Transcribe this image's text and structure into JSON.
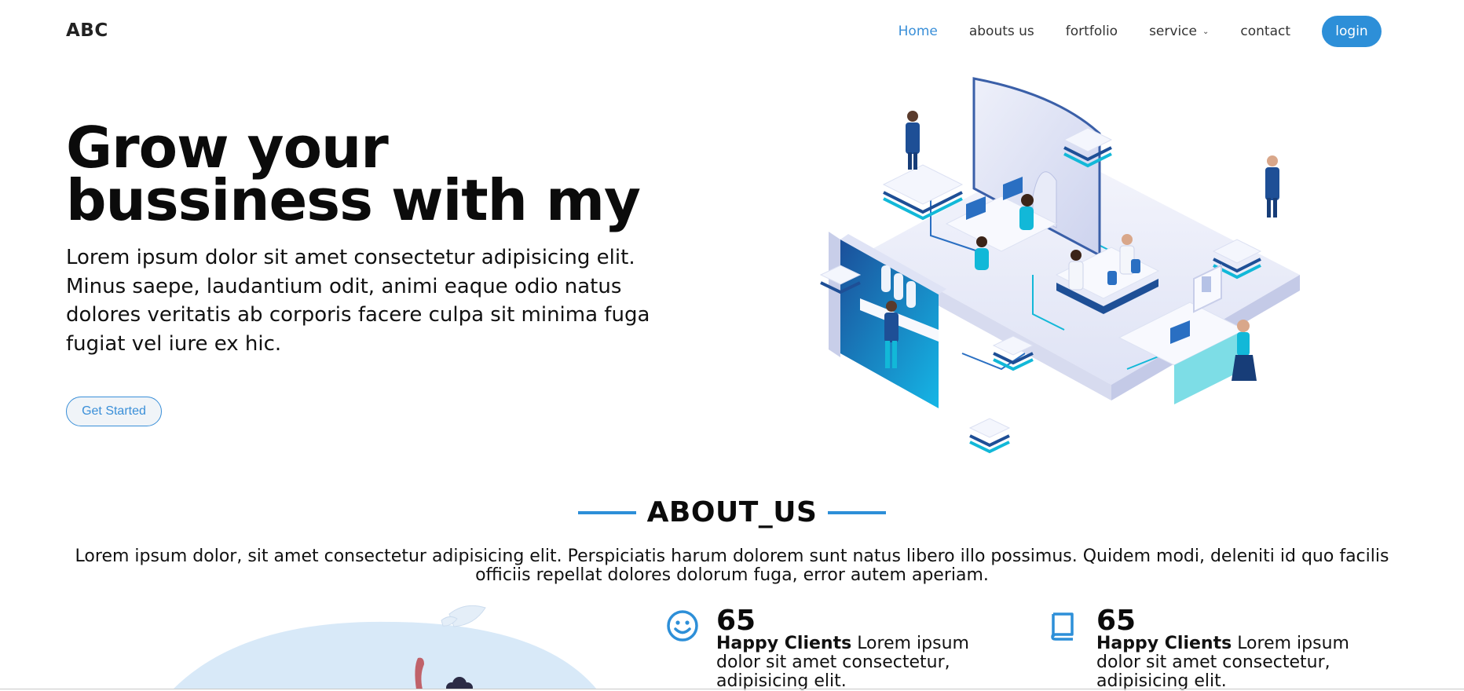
{
  "brand": "ABC",
  "nav": {
    "items": [
      "Home",
      "abouts us",
      "fortfolio",
      "service",
      "contact"
    ],
    "login_label": "login"
  },
  "hero": {
    "title": "Grow your bussiness with my",
    "text": "Lorem ipsum dolor sit amet consectetur adipisicing elit. Minus saepe, laudantium odit, animi eaque odio natus dolores veritatis ab corporis facere culpa sit minima fuga fugiat vel iure ex hic.",
    "cta": "Get Started"
  },
  "about": {
    "heading": "ABOUT_US",
    "text": "Lorem ipsum dolor, sit amet consectetur adipisicing elit. Perspiciatis harum dolorem sunt natus libero illo possimus. Quidem modi, deleniti id quo facilis officiis repellat dolores dolorum fuga, error autem aperiam.",
    "stats": [
      {
        "icon": "smiley-icon",
        "number": "65",
        "label": "Happy Clients",
        "text": "Lorem ipsum dolor sit amet consectetur, adipisicing elit."
      },
      {
        "icon": "book-icon",
        "number": "65",
        "label": "Happy Clients",
        "text": "Lorem ipsum dolor sit amet consectetur, adipisicing elit."
      }
    ]
  },
  "colors": {
    "accent": "#2d8fd8",
    "text": "#0b0b0b"
  }
}
